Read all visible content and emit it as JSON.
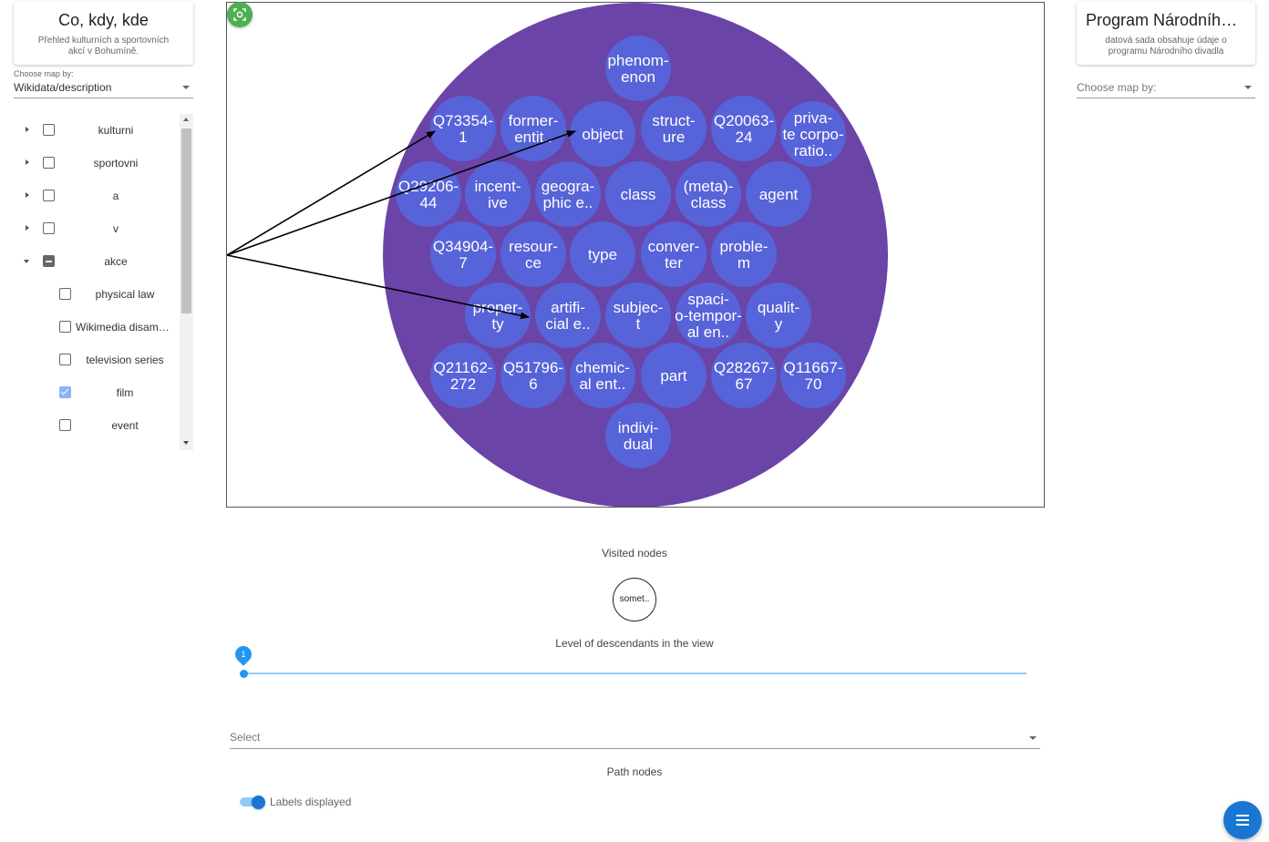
{
  "left_card": {
    "title": "Co, kdy, kde",
    "description": "Přehled kulturních a sportovních akcí v Bohumíně."
  },
  "left_select": {
    "label": "Choose map by:",
    "value": "Wikidata/description"
  },
  "tree": [
    {
      "label": "kulturni",
      "state": "unchecked",
      "expander": "closed",
      "level": 0
    },
    {
      "label": "sportovni",
      "state": "unchecked",
      "expander": "closed",
      "level": 0
    },
    {
      "label": "a",
      "state": "unchecked",
      "expander": "closed",
      "level": 0
    },
    {
      "label": "v",
      "state": "unchecked",
      "expander": "closed",
      "level": 0
    },
    {
      "label": "akce",
      "state": "indeterminate",
      "expander": "open",
      "level": 0
    },
    {
      "label": "physical law",
      "state": "unchecked",
      "expander": "none",
      "level": 1
    },
    {
      "label": "Wikimedia disambiguation page",
      "state": "unchecked",
      "expander": "none",
      "level": 1
    },
    {
      "label": "television series",
      "state": "unchecked",
      "expander": "none",
      "level": 1
    },
    {
      "label": "film",
      "state": "checked",
      "expander": "none",
      "level": 1
    },
    {
      "label": "event",
      "state": "unchecked",
      "expander": "none",
      "level": 1
    }
  ],
  "right_card": {
    "title": "Program Národního divadla",
    "description": "datová sada obsahuje údaje o programu Národního divadla"
  },
  "right_select": {
    "label": "Choose map by:"
  },
  "graph": {
    "outer_color": "#6b44a8",
    "node_color": "#5763d9",
    "nodes": [
      {
        "lines": [
          "phenom-",
          "enon"
        ]
      },
      {
        "lines": [
          "Q73354-",
          "1"
        ]
      },
      {
        "lines": [
          "former-",
          "entit.."
        ]
      },
      {
        "lines": [
          "object"
        ]
      },
      {
        "lines": [
          "struct-",
          "ure"
        ]
      },
      {
        "lines": [
          "Q20063-",
          "24"
        ]
      },
      {
        "lines": [
          "priva-",
          "te corpo-",
          "ratio.."
        ]
      },
      {
        "lines": [
          "Q29206-",
          "44"
        ]
      },
      {
        "lines": [
          "incent-",
          "ive"
        ]
      },
      {
        "lines": [
          "geogra-",
          "phic e.."
        ]
      },
      {
        "lines": [
          "class"
        ]
      },
      {
        "lines": [
          "(meta)-",
          "class"
        ]
      },
      {
        "lines": [
          "agent"
        ]
      },
      {
        "lines": [
          "Q34904-",
          "7"
        ]
      },
      {
        "lines": [
          "resour-",
          "ce"
        ]
      },
      {
        "lines": [
          "type"
        ]
      },
      {
        "lines": [
          "conver-",
          "ter"
        ]
      },
      {
        "lines": [
          "proble-",
          "m"
        ]
      },
      {
        "lines": [
          "proper-",
          "ty"
        ]
      },
      {
        "lines": [
          "artifi-",
          "cial e.."
        ]
      },
      {
        "lines": [
          "subjec-",
          "t"
        ]
      },
      {
        "lines": [
          "spaci-",
          "o-tempor-",
          "al en.."
        ]
      },
      {
        "lines": [
          "qualit-",
          "y"
        ]
      },
      {
        "lines": [
          "Q21162-",
          "272"
        ]
      },
      {
        "lines": [
          "Q51796-",
          "6"
        ]
      },
      {
        "lines": [
          "chemic-",
          "al ent.."
        ]
      },
      {
        "lines": [
          "part"
        ]
      },
      {
        "lines": [
          "Q28267-",
          "67"
        ]
      },
      {
        "lines": [
          "Q11667-",
          "70"
        ]
      },
      {
        "lines": [
          "indivi-",
          "dual"
        ]
      }
    ]
  },
  "visited": {
    "label": "Visited nodes",
    "node": "somet.."
  },
  "level": {
    "label": "Level of descendants in the view",
    "value": 1
  },
  "select_bottom": {
    "placeholder": "Select"
  },
  "path": {
    "label": "Path nodes"
  },
  "toggle": {
    "label": "Labels displayed",
    "on": true
  },
  "colors": {
    "accent": "#2196f3",
    "fab": "#1976d2",
    "fit_button": "#4caf50"
  }
}
